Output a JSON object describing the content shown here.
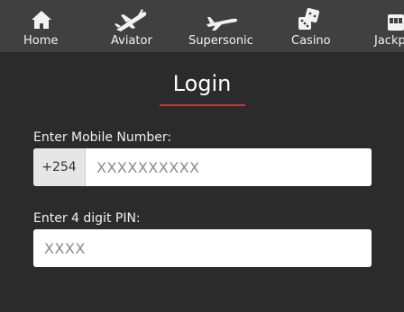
{
  "nav": {
    "items": [
      {
        "label": "Home",
        "icon": "home-icon"
      },
      {
        "label": "Aviator",
        "icon": "airplane-icon"
      },
      {
        "label": "Supersonic",
        "icon": "jet-icon"
      },
      {
        "label": "Casino",
        "icon": "dice-icon"
      },
      {
        "label": "Jackp",
        "icon": "slot-machine-icon"
      }
    ]
  },
  "login": {
    "title": "Login",
    "mobile_label": "Enter Mobile Number:",
    "country_code": "+254",
    "mobile_placeholder": "XXXXXXXXXX",
    "pin_label": "Enter 4 digit PIN:",
    "pin_placeholder": "XXXX"
  },
  "colors": {
    "background": "#2b2b2b",
    "nav_background": "#404040",
    "accent": "#c8392e"
  }
}
